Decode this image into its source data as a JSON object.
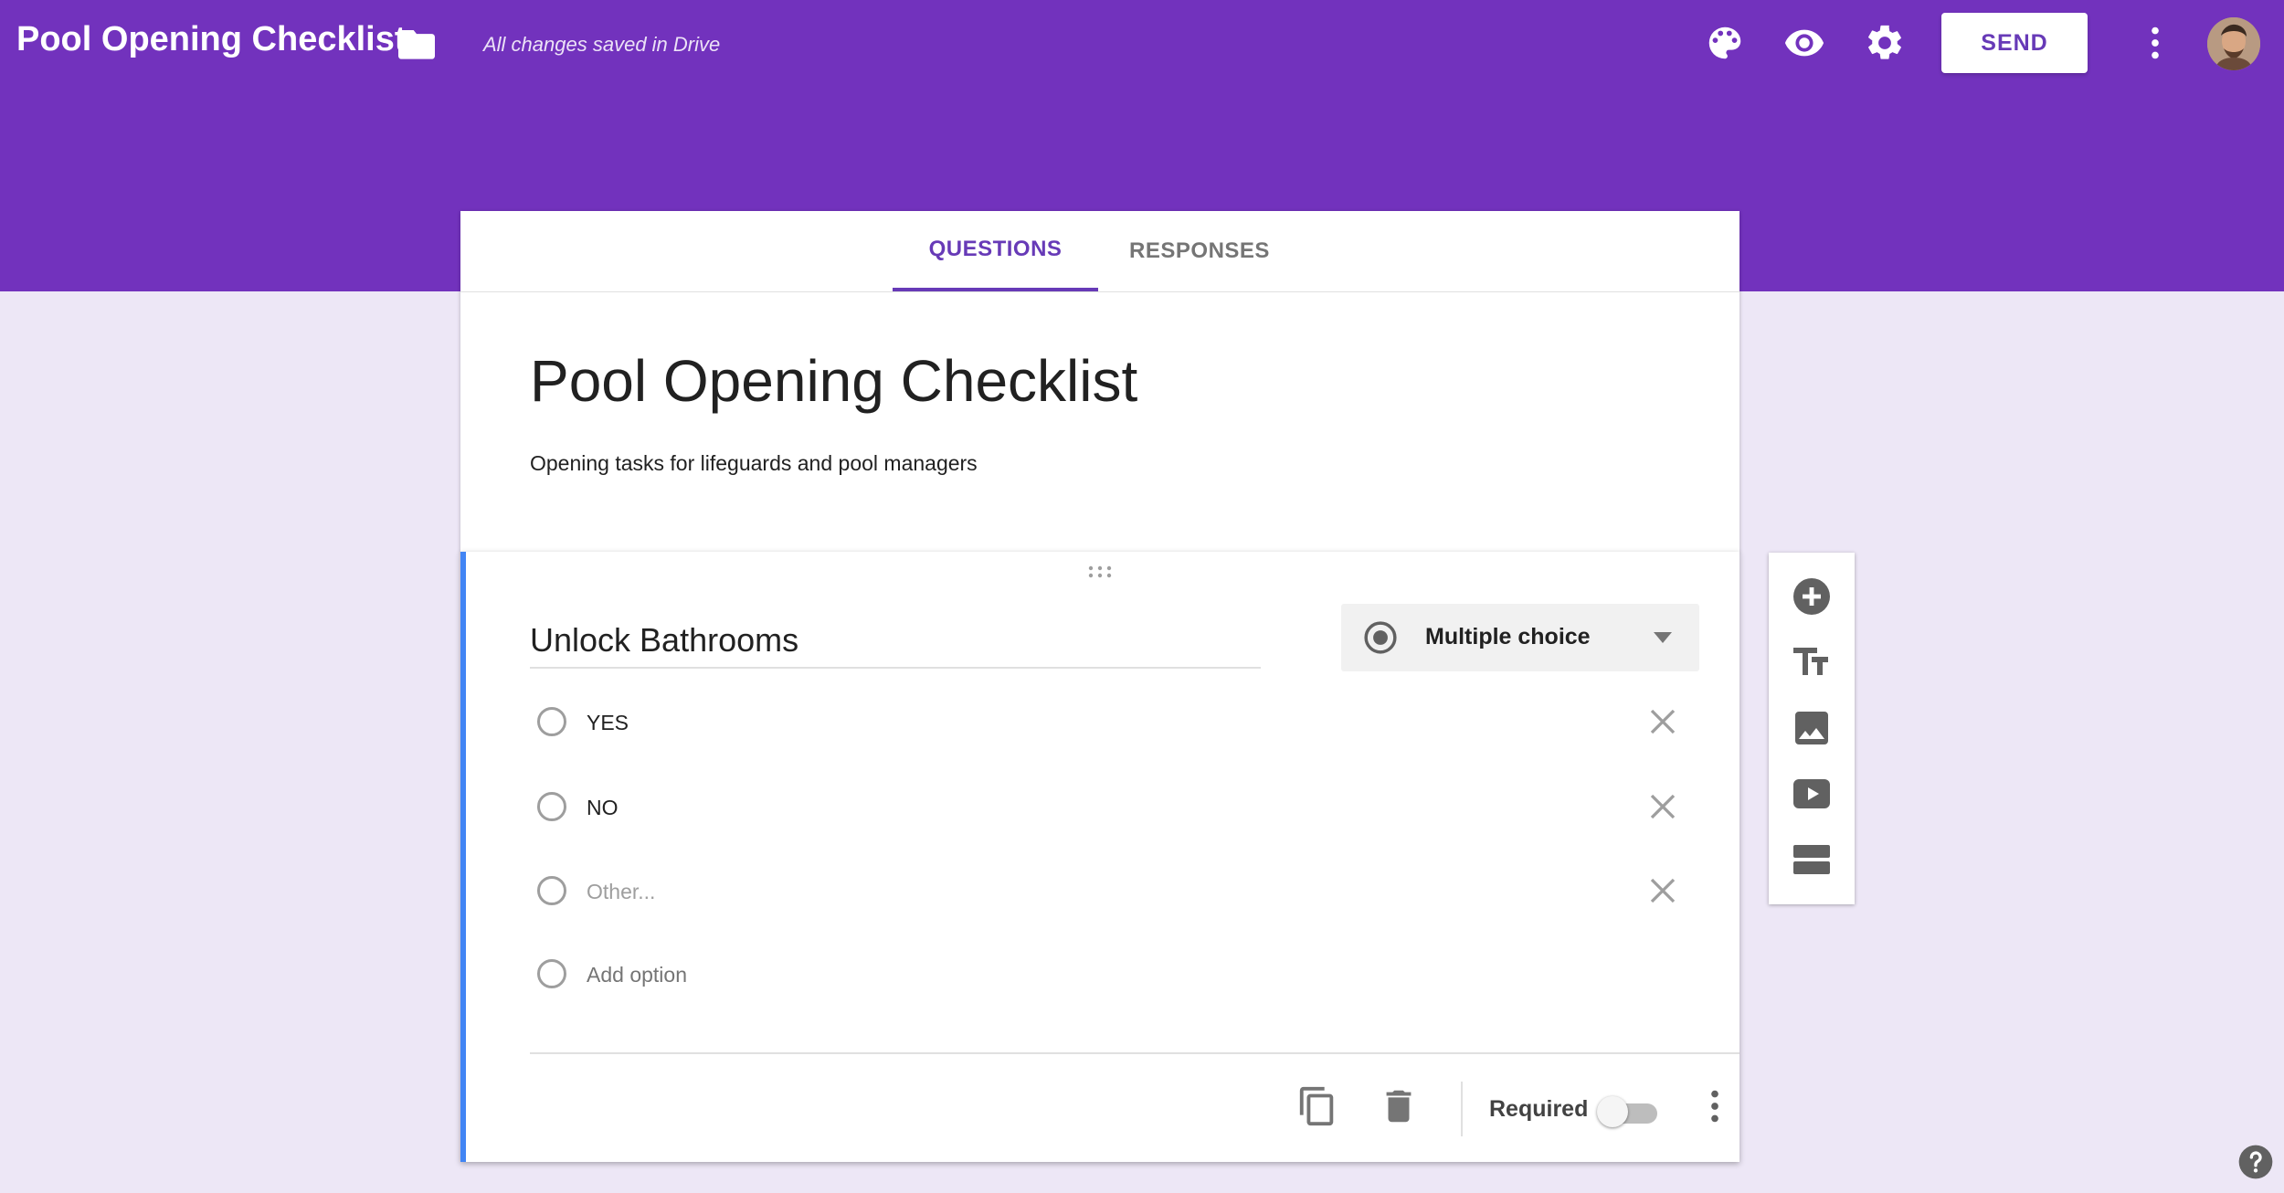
{
  "header": {
    "app_title": "Pool Opening Checklist",
    "save_status": "All changes saved in Drive",
    "send_label": "SEND",
    "icons": [
      "folder-icon",
      "palette-icon",
      "eye-icon",
      "gear-icon",
      "more-vert-icon",
      "avatar"
    ]
  },
  "tabs": [
    {
      "label": "QUESTIONS",
      "active": true
    },
    {
      "label": "RESPONSES",
      "active": false
    }
  ],
  "form": {
    "title": "Pool Opening Checklist",
    "description": "Opening tasks for lifeguards and pool managers"
  },
  "question": {
    "title": "Unlock Bathrooms",
    "type_label": "Multiple choice",
    "options": [
      {
        "label": "YES"
      },
      {
        "label": "NO"
      },
      {
        "label": "Other..."
      }
    ],
    "add_option_label": "Add option",
    "required_label": "Required",
    "required": false
  },
  "side_toolbar": [
    "add-question-icon",
    "title-text-icon",
    "image-icon",
    "video-icon",
    "section-icon"
  ],
  "colors": {
    "brand": "#7232bd",
    "accent": "#673ab7",
    "page_bg": "#ede7f6",
    "active_question_bar": "#4285f4"
  }
}
